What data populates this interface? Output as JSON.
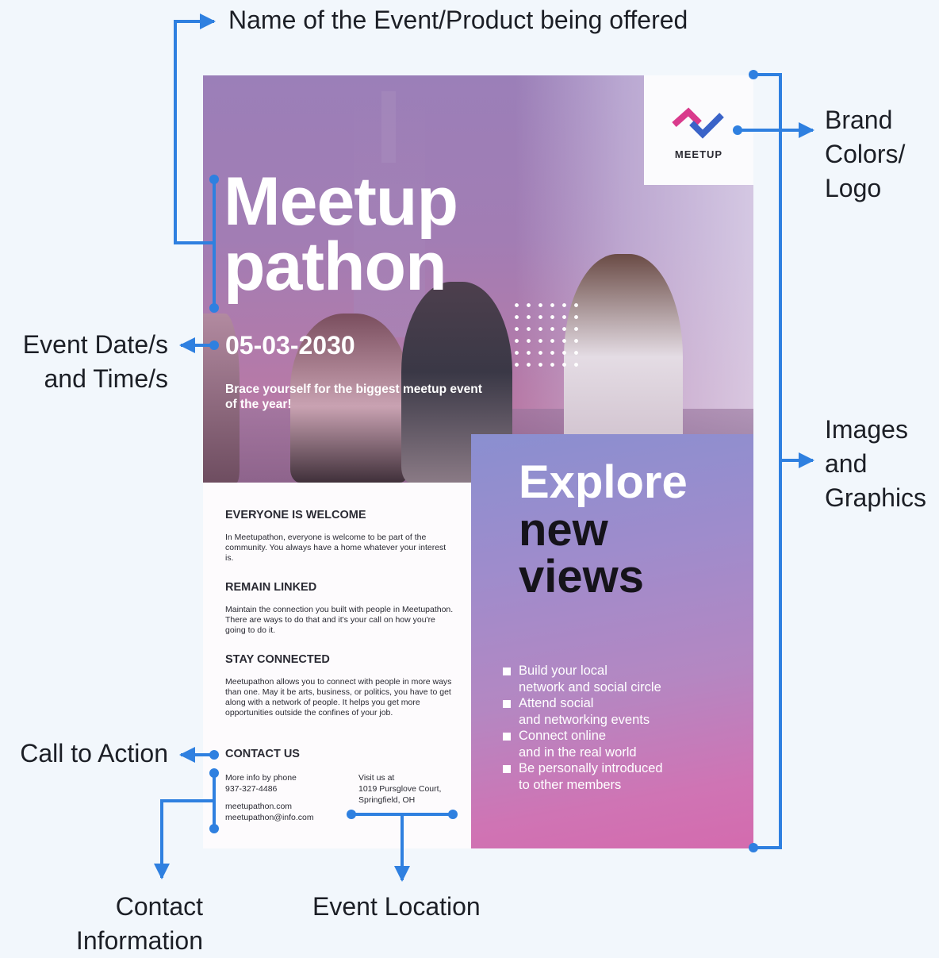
{
  "annotations": {
    "name": "Name of the Event/Product being offered",
    "brand_line1": "Brand",
    "brand_line2": "Colors/",
    "brand_line3": "Logo",
    "date_line1": "Event Date/s",
    "date_line2": "and Time/s",
    "images_line1": "Images",
    "images_line2": "and",
    "images_line3": "Graphics",
    "cta": "Call to Action",
    "contact_line1": "Contact",
    "contact_line2": "Information",
    "location": "Event Location"
  },
  "poster": {
    "logo_text": "MEETUP",
    "title_line1": "Meetup",
    "title_line2": "pathon",
    "date": "05-03-2030",
    "tagline": "Brace yourself for the biggest meetup event of the year!",
    "sections": [
      {
        "heading": "EVERYONE IS WELCOME",
        "body": "In Meetupathon, everyone is welcome to be part of the community. You always have a home whatever your interest is."
      },
      {
        "heading": "REMAIN LINKED",
        "body": "Maintain the connection you built with people in Meetupathon. There are ways to do that and it's your call on how you're going to do it."
      },
      {
        "heading": "STAY CONNECTED",
        "body": "Meetupathon allows you to connect with people in more ways than one. May it be arts, business, or politics, you have to get along with a network of people. It helps you get more opportunities outside the confines of your job."
      }
    ],
    "contact": {
      "heading": "CONTACT US",
      "phone_label": "More info by phone",
      "phone": "937-327-4486",
      "website": "meetupathon.com",
      "email": "meetupathon@info.com",
      "visit_label": "Visit us at",
      "address_line1": "1019 Pursglove Court,",
      "address_line2": "Springfield, OH"
    },
    "explore": "Explore",
    "new": "new",
    "views": "views",
    "bullets": [
      "Build your local\nnetwork and social circle",
      "Attend social\nand networking events",
      "Connect online\nand in the real world",
      "Be personally introduced\nto other members"
    ]
  },
  "colors": {
    "arrow_blue": "#2f80e0",
    "logo_pink": "#d93a8c",
    "logo_blue": "#3a63c8",
    "block_top": "#8a8fd0",
    "block_bottom": "#d46bae"
  }
}
